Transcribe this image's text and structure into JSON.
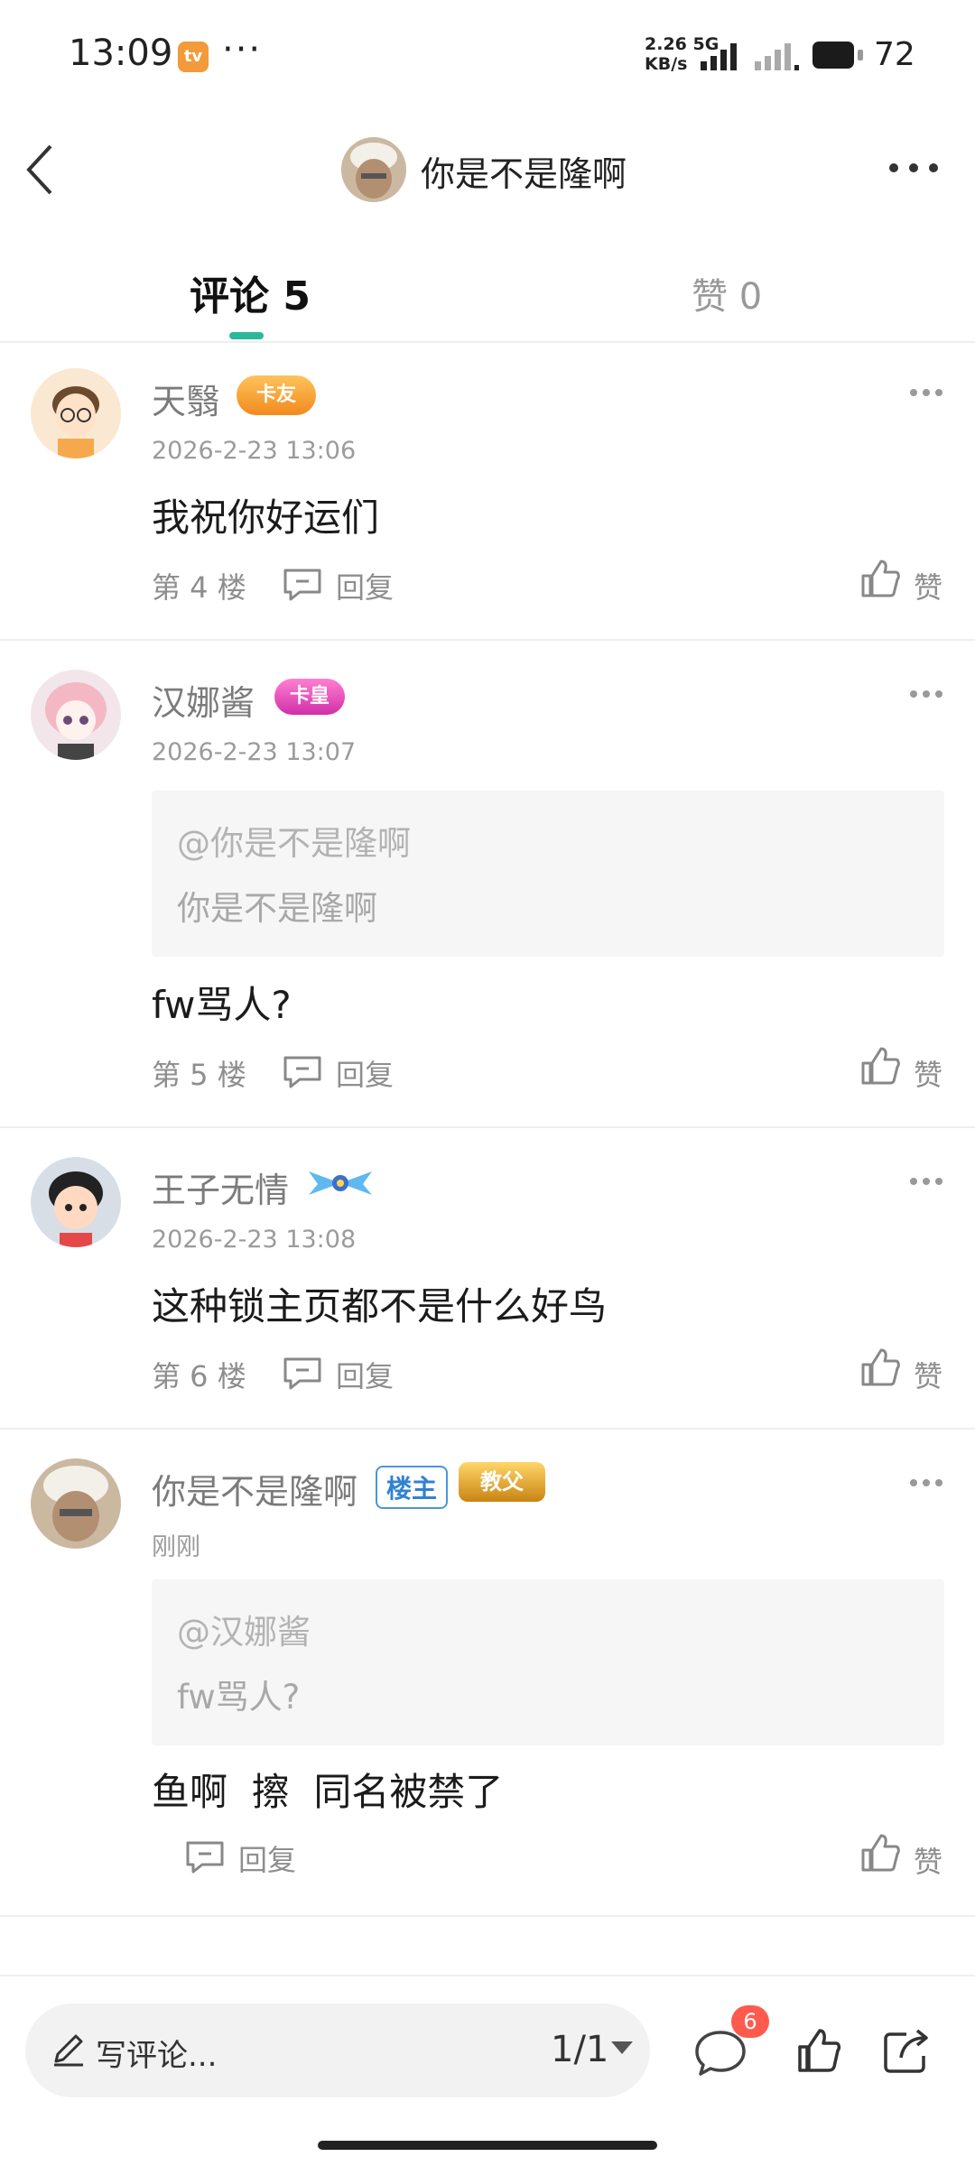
{
  "status_bar": {
    "time": "13:09",
    "app_badge": "tv",
    "more": "···",
    "net_speed_value": "2.26",
    "net_type": "5G",
    "net_unit": "KB/s",
    "battery": "72"
  },
  "header": {
    "title": "你是不是隆啊"
  },
  "tabs": {
    "comments_label": "评论 5",
    "likes_label": "赞 0"
  },
  "comments": [
    {
      "name": "天翳",
      "badge": "卡友",
      "time": "2026-2-23 13:06",
      "text": "我祝你好运们",
      "floor": "第 4 楼",
      "reply": "回复",
      "like": "赞"
    },
    {
      "name": "汉娜酱",
      "badge": "卡皇",
      "time": "2026-2-23 13:07",
      "quote_at": "@你是不是隆啊",
      "quote_text": "你是不是隆啊",
      "text": "fw骂人?",
      "floor": "第 5 楼",
      "reply": "回复",
      "like": "赞"
    },
    {
      "name": "王子无情",
      "time": "2026-2-23 13:08",
      "text": "这种锁主页都不是什么好鸟",
      "floor": "第 6 楼",
      "reply": "回复",
      "like": "赞"
    },
    {
      "name": "你是不是隆啊",
      "op_badge": "楼主",
      "badge": "教父",
      "time": "刚刚",
      "quote_at": "@汉娜酱",
      "quote_text": "fw骂人?",
      "text": "鱼啊  擦  同名被禁了",
      "reply": "回复",
      "like": "赞"
    }
  ],
  "bottom_bar": {
    "input_placeholder": "写评论...",
    "page_indicator": "1/1",
    "comment_count": "6"
  },
  "colors": {
    "accent": "#2bb79a",
    "badge_red": "#ff5a4e",
    "op_blue": "#2f83d0"
  }
}
